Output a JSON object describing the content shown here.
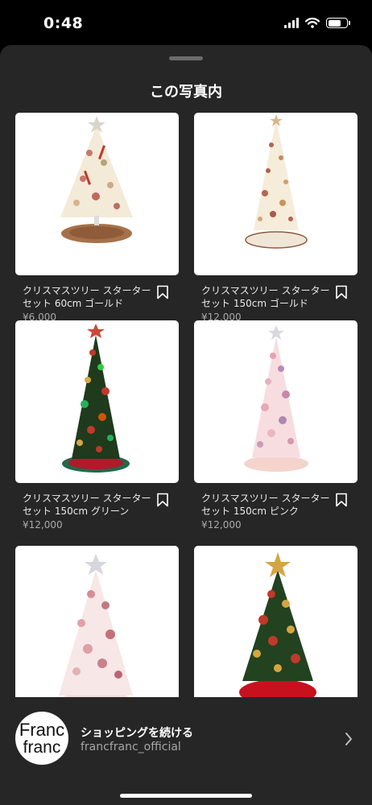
{
  "status_bar": {
    "time": "0:48"
  },
  "sheet": {
    "title": "この写真内"
  },
  "products": [
    {
      "title": "クリスマスツリー スターターセット 60cm ゴールド",
      "price": "¥6,000",
      "image": "gold-tree-60cm"
    },
    {
      "title": "クリスマスツリー スターターセット 150cm ゴールド",
      "price": "¥12,000",
      "image": "gold-tree-150cm"
    },
    {
      "title": "クリスマスツリー スターターセット 150cm グリーン",
      "price": "¥12,000",
      "image": "green-tree-150cm"
    },
    {
      "title": "クリスマスツリー スターターセット 150cm ピンク",
      "price": "¥12,000",
      "image": "pink-tree-150cm"
    },
    {
      "title": "",
      "price": "",
      "image": "white-pink-tree"
    },
    {
      "title": "",
      "price": "",
      "image": "green-red-tree"
    }
  ],
  "shop": {
    "cta": "ショッピングを続ける",
    "account": "francfranc_official",
    "logo_line1": "Franc",
    "logo_line2": "franc"
  },
  "colors": {
    "sheet_bg": "#262626",
    "accent_text": "#ffffff",
    "muted_text": "#a9a9a9"
  }
}
